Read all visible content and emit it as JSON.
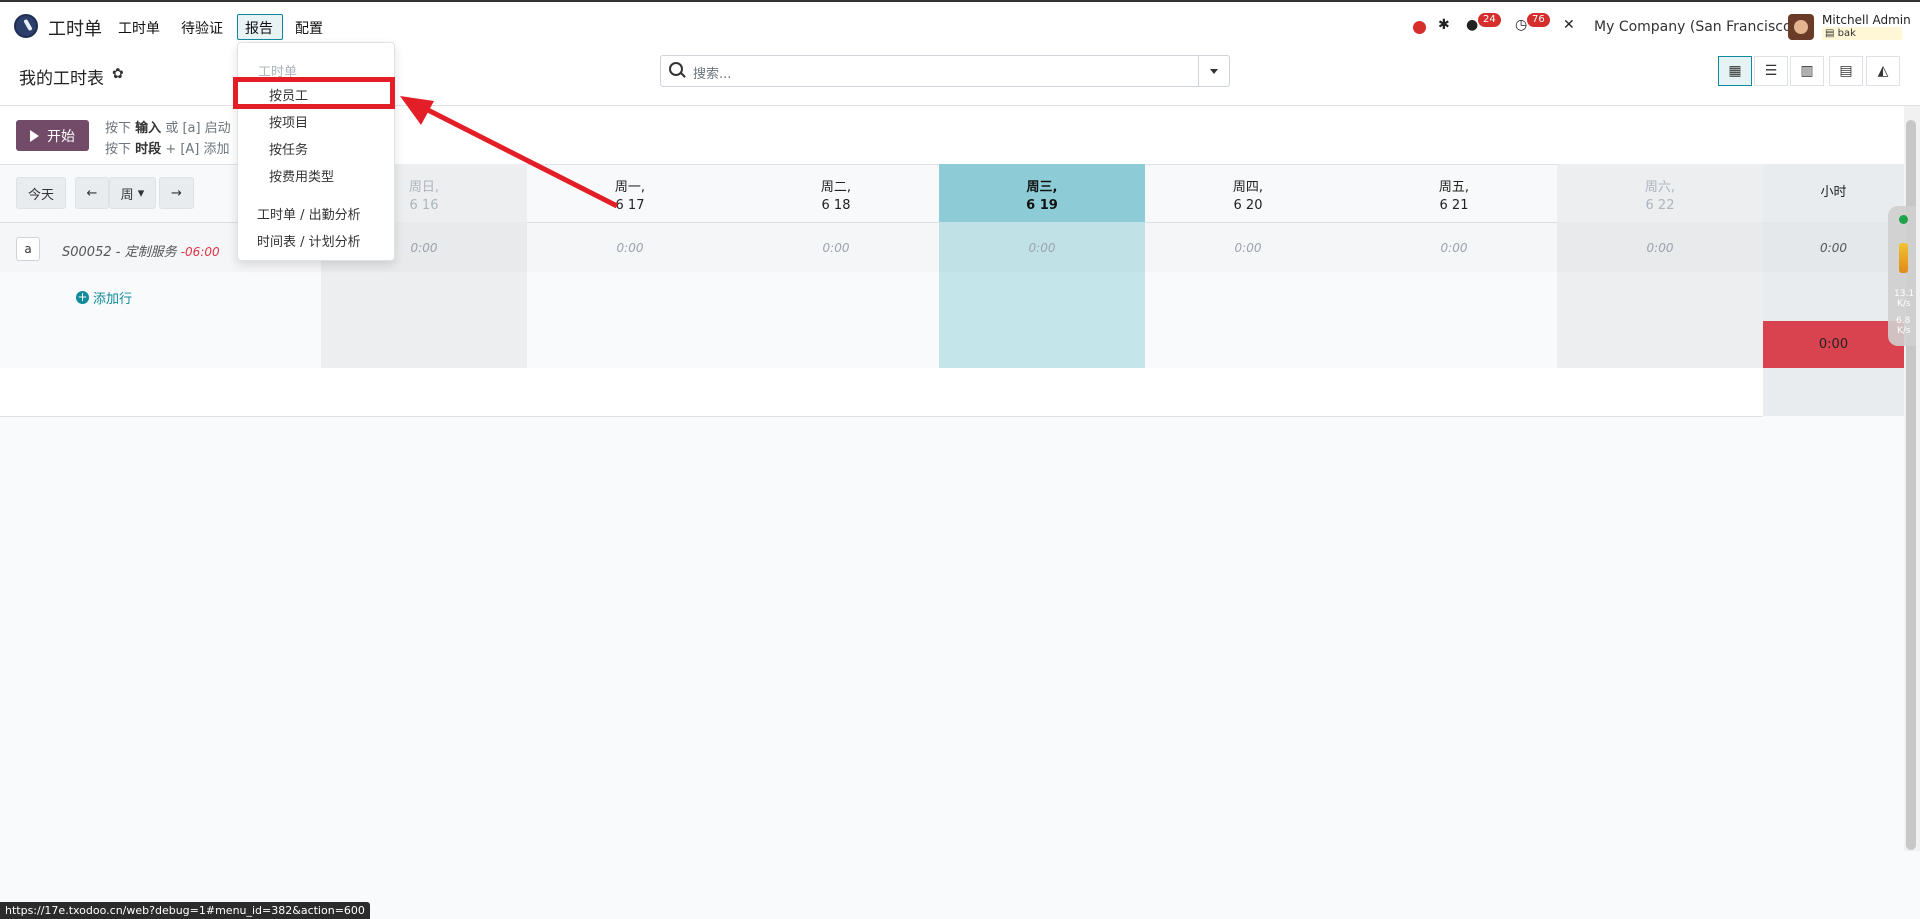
{
  "app": {
    "title": "工时单"
  },
  "topmenu": [
    "工时单",
    "待验证",
    "报告",
    "配置"
  ],
  "systray": {
    "messages_count": "24",
    "activities_count": "76",
    "company": "My Company (San Francisco)",
    "user_name": "Mitchell Admin",
    "db_name": "bak"
  },
  "control": {
    "page_title": "我的工时表",
    "search_placeholder": "搜索..."
  },
  "startbar": {
    "start_label": "开始",
    "hint1_pre": "按下",
    "hint1_key": "输入",
    "hint1_post": "或 [a] 启动",
    "hint2_pre": "按下",
    "hint2_key": "时段",
    "hint2_post": "+ [A] 添加"
  },
  "nav": {
    "today": "今天",
    "period": "周"
  },
  "days": [
    {
      "name": "周日,",
      "date": "6 16"
    },
    {
      "name": "周一,",
      "date": "6 17"
    },
    {
      "name": "周二,",
      "date": "6 18"
    },
    {
      "name": "周三,",
      "date": "6 19"
    },
    {
      "name": "周四,",
      "date": "6 20"
    },
    {
      "name": "周五,",
      "date": "6 21"
    },
    {
      "name": "周六,",
      "date": "6 22"
    }
  ],
  "hours_header": "小时",
  "row": {
    "task_key": "a",
    "label": "S00052 - 定制服务",
    "offset": "-06:00",
    "values": [
      "0:00",
      "0:00",
      "0:00",
      "0:00",
      "0:00",
      "0:00",
      "0:00"
    ],
    "total": "0:00"
  },
  "add_line": "添加行",
  "grand_total": "0:00",
  "dropdown": {
    "header": "工时单",
    "items": [
      "按员工",
      "按项目",
      "按任务",
      "按费用类型"
    ],
    "items2": [
      "工时单 / 出勤分析",
      "时间表 / 计划分析"
    ]
  },
  "widget": {
    "up": "13.1",
    "up_unit": "K/s",
    "down": "6.8",
    "down_unit": "K/s"
  },
  "status_url": "https://17e.txodoo.cn/web?debug=1#menu_id=382&action=600"
}
